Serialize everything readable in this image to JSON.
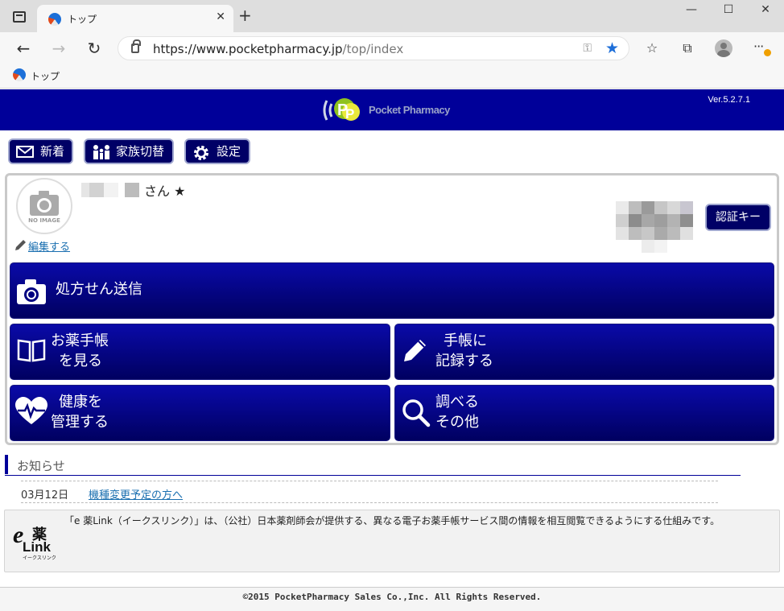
{
  "browser": {
    "tab_title": "トップ",
    "tab_close": "✕",
    "new_tab": "+",
    "window_controls": {
      "minimize": "—",
      "maximize": "☐",
      "close": "✕"
    },
    "url_host": "https://www.pocketpharmacy.jp",
    "url_path": "/top/index",
    "favorites": [
      {
        "label": "トップ"
      }
    ],
    "icons": {
      "back": "←",
      "forward": "→",
      "reload": "↻",
      "key": "⚿",
      "star": "★",
      "favorites_list": "☆",
      "collections": "⧉",
      "more": "···"
    },
    "accent_color": "#1e6fd9"
  },
  "site": {
    "brand": "Pocket Pharmacy",
    "version": "Ver.5.2.7.1",
    "header_color": "#000099",
    "top_buttons": [
      {
        "label": "新着",
        "icon": "mail-icon"
      },
      {
        "label": "家族切替",
        "icon": "family-icon"
      },
      {
        "label": "設定",
        "icon": "gear-icon"
      }
    ]
  },
  "profile": {
    "no_image": "NO IMAGE",
    "honorific": "さん ★",
    "edit_label": "編集する",
    "auth_key_button": "認証キー"
  },
  "menu": {
    "prescription": {
      "label": "処方せん送信",
      "icon": "camera-icon"
    },
    "notebook": {
      "line1": "お薬手帳",
      "line2": "を見る",
      "icon": "book-icon"
    },
    "record": {
      "line1": "手帳に",
      "line2": "記録する",
      "icon": "pencil-icon"
    },
    "health": {
      "line1": "健康を",
      "line2": "管理する",
      "icon": "heart-icon"
    },
    "search": {
      "line1": "調べる",
      "line2": "その他",
      "icon": "magnifier-icon"
    }
  },
  "notices": {
    "title": "お知らせ",
    "items": [
      {
        "date": "03月12日",
        "text": "機種変更予定の方へ"
      }
    ]
  },
  "elink": {
    "logo_e": "e",
    "logo_yaku": "薬",
    "logo_link": "Link",
    "logo_kana": "イークスリンク",
    "description": "「e 薬Link（イークスリンク）」は、（公社）日本薬剤師会が提供する、異なる電子お薬手帳サービス間の情報を相互閲覧できるようにする仕組みです。"
  },
  "footer": {
    "copyright": "©2015 PocketPharmacy Sales Co.,Inc. All Rights Reserved."
  }
}
